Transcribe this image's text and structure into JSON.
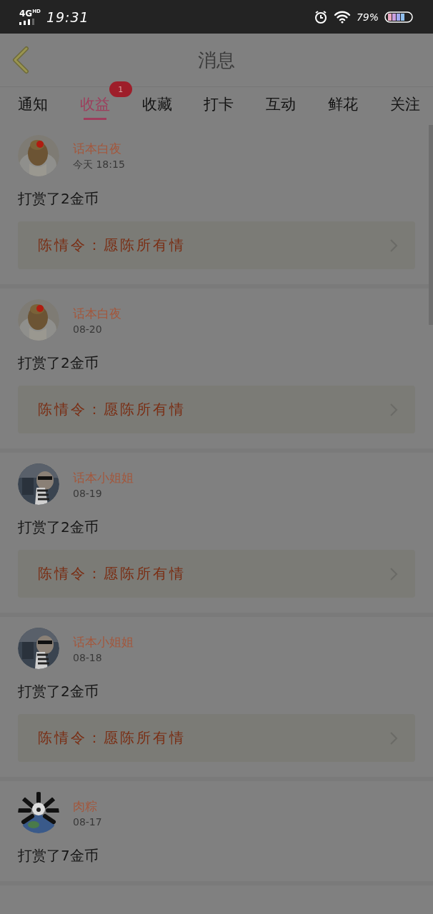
{
  "status_bar": {
    "network": "4G",
    "network_sub": "HD",
    "time": "19:31",
    "battery": "79%"
  },
  "header": {
    "title": "消息"
  },
  "tabs": [
    {
      "label": "通知",
      "selected": false
    },
    {
      "label": "收益",
      "selected": true,
      "badge": "1"
    },
    {
      "label": "收藏",
      "selected": false
    },
    {
      "label": "打卡",
      "selected": false
    },
    {
      "label": "互动",
      "selected": false
    },
    {
      "label": "鲜花",
      "selected": false
    },
    {
      "label": "关注",
      "selected": false
    }
  ],
  "messages": [
    {
      "user": "话本白夜",
      "time": "今天 18:15",
      "text": "打赏了2金币",
      "link": "陈情令：愿陈所有情"
    },
    {
      "user": "话本白夜",
      "time": "08-20",
      "text": "打赏了2金币",
      "link": "陈情令：愿陈所有情"
    },
    {
      "user": "话本小姐姐",
      "time": "08-19",
      "text": "打赏了2金币",
      "link": "陈情令：愿陈所有情"
    },
    {
      "user": "话本小姐姐",
      "time": "08-18",
      "text": "打赏了2金币",
      "link": "陈情令：愿陈所有情"
    },
    {
      "user": "肉粽",
      "time": "08-17",
      "text": "打赏了7金币"
    }
  ]
}
